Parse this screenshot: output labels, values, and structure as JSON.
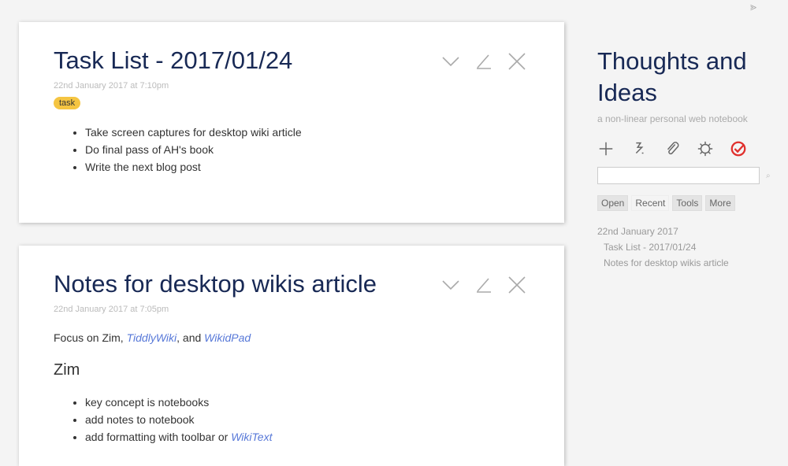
{
  "tiddlers": [
    {
      "title": "Task List - 2017/01/24",
      "date": "22nd January 2017 at 7:10pm",
      "tag": "task",
      "items": [
        "Take screen captures for desktop wiki article",
        "Do final pass of AH's book",
        "Write the next blog post"
      ]
    },
    {
      "title": "Notes for desktop wikis article",
      "date": "22nd January 2017 at 7:05pm",
      "intro": {
        "text": "Focus on Zim,",
        "link1": "TiddlyWiki",
        "and": ", and",
        "link2": "WikidPad"
      },
      "heading": "Zim",
      "items": [
        "key concept is notebooks",
        "add notes to notebook",
        "add formatting with toolbar or"
      ],
      "items_link": "WikiText"
    }
  ],
  "sidebar": {
    "title": "Thoughts and Ideas",
    "subtitle": "a non-linear personal web notebook",
    "more": "⪢",
    "search": {
      "value": "",
      "icon": "⌕"
    },
    "tabs": [
      "Open",
      "Recent",
      "Tools",
      "More"
    ],
    "recent": {
      "date": "22nd January 2017",
      "items": [
        "Task List - 2017/01/24",
        "Notes for desktop wikis article"
      ]
    }
  },
  "colors": {
    "accent": "#182955",
    "tag": "#f5c542",
    "link": "#5778d8",
    "check": "#e0302d"
  }
}
